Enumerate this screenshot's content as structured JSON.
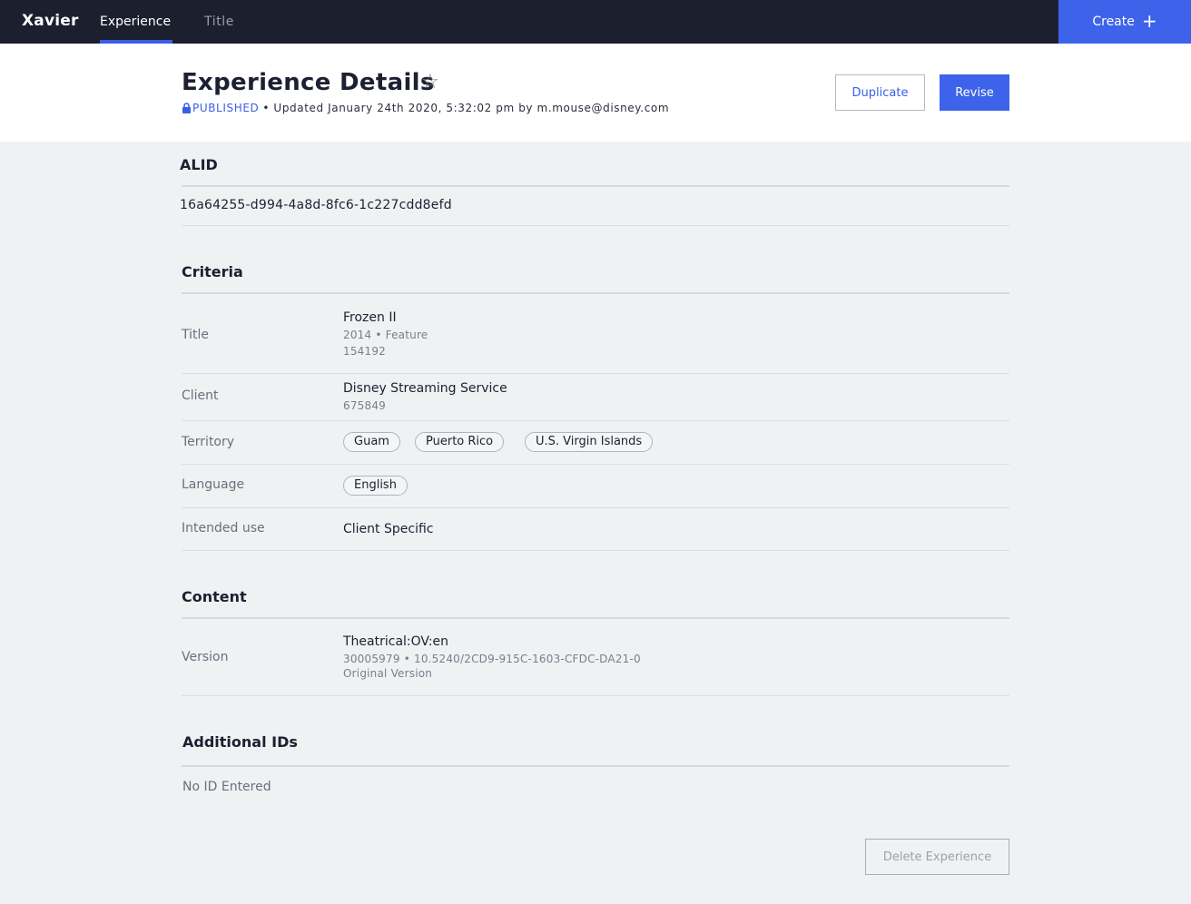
{
  "nav": {
    "brand": "Xavier",
    "tabs": [
      {
        "label": "Experience",
        "active": true
      },
      {
        "label": "Title",
        "active": false
      }
    ],
    "create_label": "Create",
    "create_icon": "plus-icon"
  },
  "header": {
    "title": "Experience Details",
    "star_icon": "star-outline-icon",
    "status_icon": "lock-icon",
    "status": "PUBLISHED",
    "updated_text": "• Updated January 24th 2020, 5:32:02 pm by m.mouse@disney.com",
    "duplicate_label": "Duplicate",
    "revise_label": "Revise"
  },
  "alid": {
    "heading": "ALID",
    "value": "16a64255-d994-4a8d-8fc6-1c227cdd8efd"
  },
  "criteria": {
    "heading": "Criteria",
    "title": {
      "label": "Title",
      "name": "Frozen II",
      "meta": "2014 • Feature",
      "id": "154192"
    },
    "client": {
      "label": "Client",
      "name": "Disney Streaming Service",
      "id": "675849"
    },
    "territory": {
      "label": "Territory",
      "values": [
        "Guam",
        "Puerto Rico",
        "U.S. Virgin Islands"
      ]
    },
    "language": {
      "label": "Language",
      "values": [
        "English"
      ]
    },
    "intended_use": {
      "label": "Intended use",
      "value": "Client Specific"
    }
  },
  "content": {
    "heading": "Content",
    "version": {
      "label": "Version",
      "name": "Theatrical:OV:en",
      "ids": "30005979 • 10.5240/2CD9-915C-1603-CFDC-DA21-0",
      "type": "Original Version"
    }
  },
  "additional_ids": {
    "heading": "Additional IDs",
    "empty_text": "No ID Entered"
  },
  "footer": {
    "delete_label": "Delete Experience"
  },
  "colors": {
    "accent": "#3d63ea",
    "nav_bg": "#1c1f2e",
    "page_bg": "#f0f1f3"
  }
}
